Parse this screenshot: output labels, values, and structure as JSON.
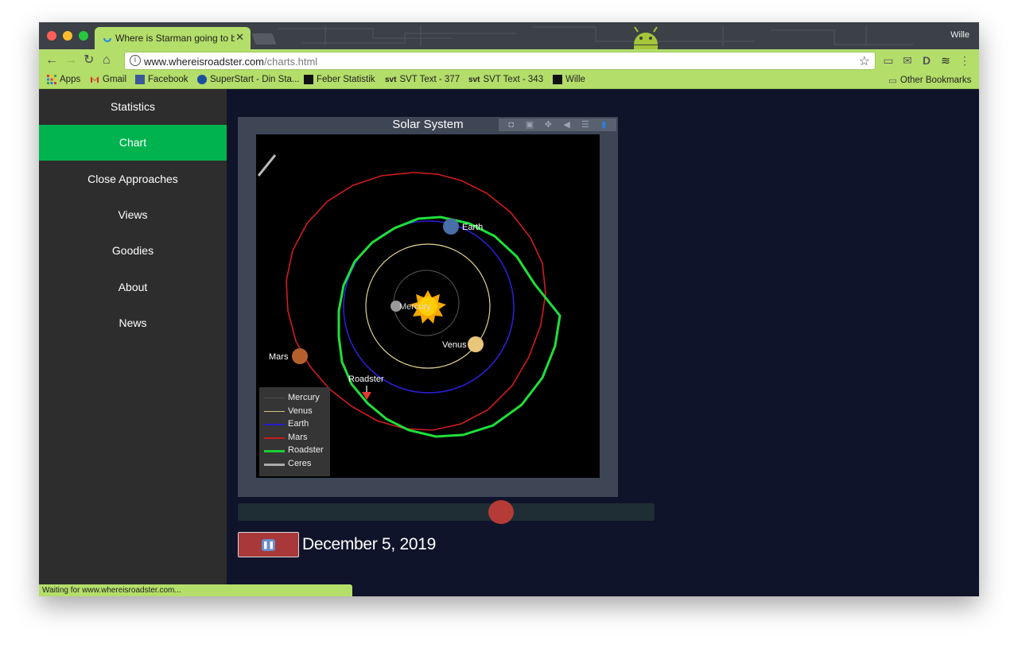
{
  "browser": {
    "tab_title": "Where is Starman going to be",
    "tab_close": "✕",
    "profile_name": "Wille",
    "url_host": "www.whereisroadster.com",
    "url_path": "/charts.html",
    "status_text": "Waiting for www.whereisroadster.com...",
    "bookmarks": [
      {
        "label": "Apps",
        "icon": "apps-grid-icon"
      },
      {
        "label": "Gmail",
        "icon": "gmail-icon"
      },
      {
        "label": "Facebook",
        "icon": "facebook-icon"
      },
      {
        "label": "SuperStart - Din Sta...",
        "icon": "superstart-icon"
      },
      {
        "label": "Feber Statistik",
        "icon": "feber-icon"
      },
      {
        "label": "SVT Text - 377",
        "icon": "svt-icon"
      },
      {
        "label": "SVT Text - 343",
        "icon": "svt-icon"
      },
      {
        "label": "Wille",
        "icon": "feber-icon"
      }
    ],
    "other_bookmarks": "Other Bookmarks",
    "svt_prefix": "svt",
    "icon_glyphs": {
      "back": "←",
      "forward": "→",
      "reload": "↻",
      "home": "⌂",
      "star": "☆",
      "info": "i",
      "folder": "▭",
      "camera": "◘",
      "save": "▣",
      "pan": "✥",
      "zoom": "◀",
      "hover": "☰",
      "plotly": "▮",
      "pause": "❚❚",
      "menu": "⋮",
      "cast": "▭",
      "mail": "✉",
      "ext_d": "D",
      "ext_stack": "≋"
    }
  },
  "sidebar": {
    "items": [
      {
        "label": "Statistics",
        "active": false
      },
      {
        "label": "Chart",
        "active": true
      },
      {
        "label": "Close Approaches",
        "active": false
      },
      {
        "label": "Views",
        "active": false
      },
      {
        "label": "Goodies",
        "active": false
      },
      {
        "label": "About",
        "active": false
      },
      {
        "label": "News",
        "active": false
      }
    ]
  },
  "plot": {
    "title": "Solar System",
    "date": "December 5, 2019",
    "slider_fraction": 0.64
  },
  "chart_data": {
    "type": "scatter",
    "title": "Solar System",
    "xlabel": "",
    "ylabel": "",
    "grid": false,
    "legend_placement": "bottom-left",
    "series": [
      {
        "name": "Mercury",
        "color": "#555555"
      },
      {
        "name": "Venus",
        "color": "#e4d38e"
      },
      {
        "name": "Earth",
        "color": "#2a1fd6"
      },
      {
        "name": "Mars",
        "color": "#d11c1c"
      },
      {
        "name": "Roadster",
        "color": "#1ee03a"
      },
      {
        "name": "Ceres",
        "color": "#b8b8b8"
      }
    ],
    "body_labels": [
      {
        "name": "Mercury"
      },
      {
        "name": "Venus"
      },
      {
        "name": "Earth"
      },
      {
        "name": "Mars"
      },
      {
        "name": "Roadster"
      }
    ]
  }
}
